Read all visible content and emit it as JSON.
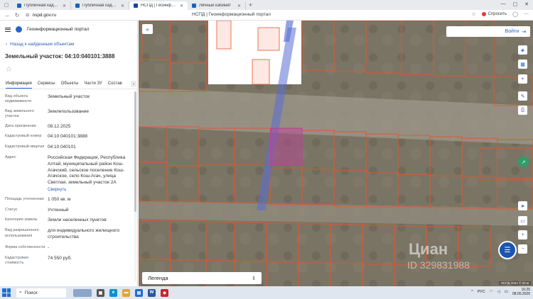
{
  "browser": {
    "tabs": [
      {
        "label": "Публичная кадастровая",
        "active": false,
        "icon": "globe-icon"
      },
      {
        "label": "Публичная кадастровая",
        "active": false,
        "icon": "globe-icon"
      },
      {
        "label": "НСПД | Геоинформационн",
        "active": true,
        "icon": "nspd-icon"
      },
      {
        "label": "Личный кабинет",
        "active": false,
        "icon": "cabinet-icon"
      }
    ],
    "url": "nspd.gov.ru",
    "page_title": "НСПД | Геоинформационный портал",
    "share_label": "Спросить"
  },
  "panel": {
    "app_name": "Геоинформационный портал",
    "back_link": "Назад к найденным объектам",
    "title": "Земельный участок: 04:10:040101:3888",
    "tabs": [
      "Информация",
      "Сервисы",
      "Объекты",
      "Части ЗУ",
      "Состав"
    ],
    "rows": [
      {
        "key": "Вид объекта недвижимости",
        "value": "Земельный участок"
      },
      {
        "key": "Вид земельного участка",
        "value": "Землепользование"
      },
      {
        "key": "Дата присвоения",
        "value": "08.12.2025"
      },
      {
        "key": "Кадастровый номер",
        "value": "04:10:040101:3888"
      },
      {
        "key": "Кадастровый квартал",
        "value": "04:10:040101"
      },
      {
        "key": "Адрес",
        "value": "Российская Федерация, Республика Алтай, муниципальный район Кош-Агачский, сельское поселение Кош-Агачское, село Кош-Агач, улица Светлая, земельный участок 2А",
        "link": "Свернуть"
      },
      {
        "key": "Площадь уточненная",
        "value": "1 050 кв. м"
      },
      {
        "key": "Статус",
        "value": "Учтенный"
      },
      {
        "key": "Категория земель",
        "value": "Земли населенных пунктов"
      },
      {
        "key": "Вид разрешенного использования",
        "value": "для индивидуального жилищного строительства"
      },
      {
        "key": "Форма собственности",
        "value": "-"
      },
      {
        "key": "Кадастровая стоимость",
        "value": "74 550 руб."
      }
    ]
  },
  "map": {
    "login_label": "Войти",
    "legend_label": "Легенда",
    "watermark": "Циан",
    "watermark_id": "ID 329831988",
    "attribution": "НСПД 2024 ©   20 м",
    "parcel_color": "#e8542a",
    "selected_color": "#c0409a",
    "accent": "#2566c9"
  },
  "taskbar": {
    "search_placeholder": "Поиск",
    "tray_lang": "РУС",
    "time": "16:25",
    "date": "08.05.2026"
  }
}
